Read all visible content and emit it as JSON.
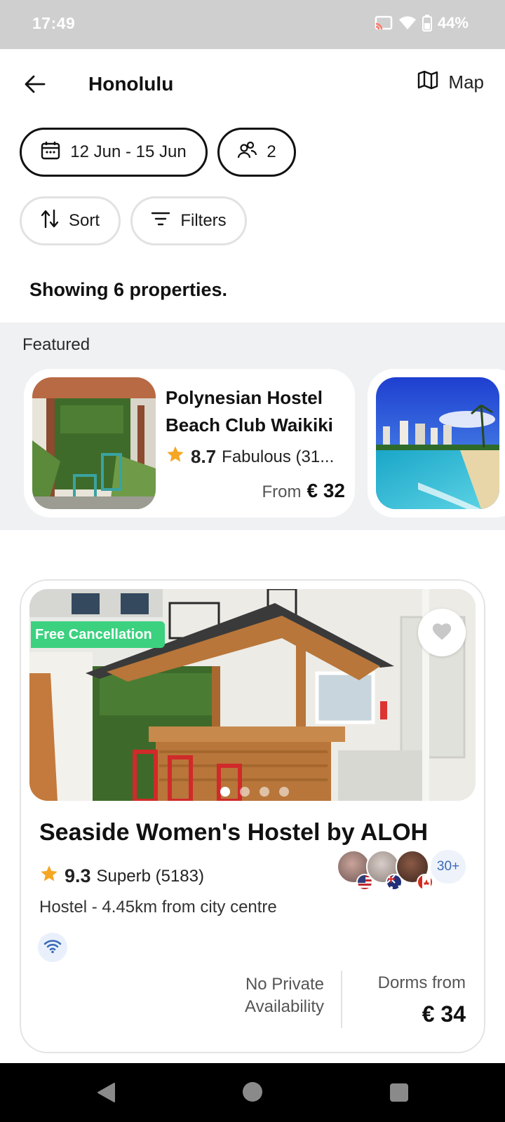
{
  "status_bar": {
    "time": "17:49",
    "battery": "44%",
    "icons": [
      "cast-icon",
      "wifi-icon",
      "battery-icon"
    ]
  },
  "header": {
    "title": "Honolulu",
    "map_label": "Map",
    "icons": [
      "back-arrow-icon",
      "map-icon"
    ]
  },
  "search": {
    "dates": "12 Jun - 15 Jun",
    "guests": "2",
    "sort_label": "Sort",
    "filters_label": "Filters",
    "icons": [
      "calendar-icon",
      "guests-icon",
      "sort-icon",
      "filter-icon"
    ]
  },
  "results": {
    "count_text": "Showing 6 properties."
  },
  "featured": {
    "label": "Featured",
    "cards": [
      {
        "name": "Polynesian Hostel Beach Club Waikiki",
        "rating_score": "8.7",
        "rating_text": "Fabulous (31...",
        "price_prefix": "From",
        "price": "€ 32"
      }
    ]
  },
  "property": {
    "badge": "Free Cancellation",
    "title": "Seaside Women's Hostel by ALOH",
    "rating_score": "9.3",
    "rating_text": "Superb (5183)",
    "more_guests": "30+",
    "subtitle": "Hostel - 4.45km from city centre",
    "private_availability": "No Private Availability",
    "dorms_label": "Dorms from",
    "dorms_price": "€ 34",
    "photo_index": 1,
    "photo_count": 4,
    "guest_flags": [
      "us-flag-icon",
      "australia-flag-icon",
      "canada-flag-icon"
    ],
    "icons": [
      "heart-icon",
      "star-icon",
      "wifi-icon"
    ]
  },
  "colors": {
    "badge_green": "#3bd17f",
    "star": "#f5a623",
    "accent_blue": "#3a6ab8",
    "featured_bg": "#f0f1f3"
  }
}
